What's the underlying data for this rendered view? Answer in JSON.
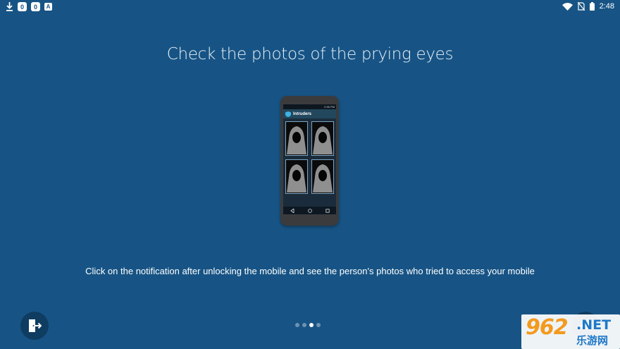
{
  "status_bar": {
    "left_icons": [
      "download-icon",
      "notification-badge-icon",
      "notification-badge-icon",
      "a-icon"
    ],
    "left_badges": [
      "0",
      "0",
      "A"
    ],
    "right_icons": [
      "wifi-icon",
      "no-sim-icon",
      "battery-icon"
    ],
    "time": "2:48"
  },
  "headline": "Check the photos of the prying eyes",
  "phone_preview": {
    "status_time": "2:36 PM",
    "app_title": "Intruders",
    "tiles": 4
  },
  "description": "Click on the notification after unlocking the mobile and see the person's photos who tried to access your mobile",
  "pager": {
    "total": 4,
    "active": 2
  },
  "buttons": {
    "exit_icon": "exit-door-icon",
    "next_icon": "next-arrow-icon"
  },
  "watermark": {
    "main": "962",
    "net": ".NET",
    "sub": "乐游网"
  },
  "colors": {
    "background": "#175485",
    "button": "#0f3c61",
    "dot_active": "#ffffff",
    "dot_inactive": "#6e92b4"
  }
}
